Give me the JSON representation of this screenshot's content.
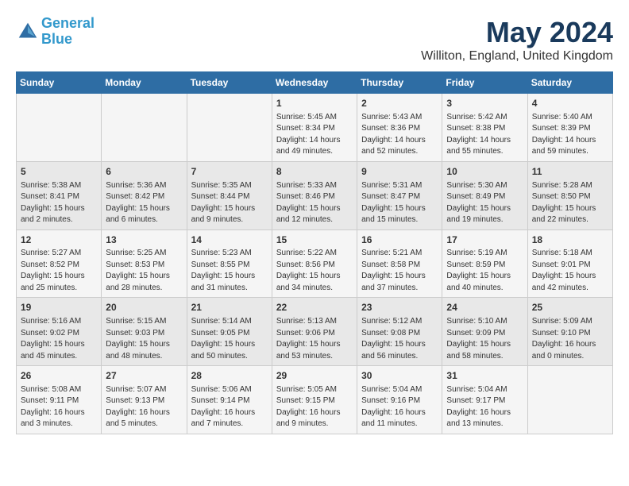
{
  "header": {
    "logo_line1": "General",
    "logo_line2": "Blue",
    "month_title": "May 2024",
    "location": "Williton, England, United Kingdom"
  },
  "days_of_week": [
    "Sunday",
    "Monday",
    "Tuesday",
    "Wednesday",
    "Thursday",
    "Friday",
    "Saturday"
  ],
  "rows": [
    {
      "cells": [
        {
          "day": "",
          "content": ""
        },
        {
          "day": "",
          "content": ""
        },
        {
          "day": "",
          "content": ""
        },
        {
          "day": "1",
          "content": "Sunrise: 5:45 AM\nSunset: 8:34 PM\nDaylight: 14 hours\nand 49 minutes."
        },
        {
          "day": "2",
          "content": "Sunrise: 5:43 AM\nSunset: 8:36 PM\nDaylight: 14 hours\nand 52 minutes."
        },
        {
          "day": "3",
          "content": "Sunrise: 5:42 AM\nSunset: 8:38 PM\nDaylight: 14 hours\nand 55 minutes."
        },
        {
          "day": "4",
          "content": "Sunrise: 5:40 AM\nSunset: 8:39 PM\nDaylight: 14 hours\nand 59 minutes."
        }
      ]
    },
    {
      "cells": [
        {
          "day": "5",
          "content": "Sunrise: 5:38 AM\nSunset: 8:41 PM\nDaylight: 15 hours\nand 2 minutes."
        },
        {
          "day": "6",
          "content": "Sunrise: 5:36 AM\nSunset: 8:42 PM\nDaylight: 15 hours\nand 6 minutes."
        },
        {
          "day": "7",
          "content": "Sunrise: 5:35 AM\nSunset: 8:44 PM\nDaylight: 15 hours\nand 9 minutes."
        },
        {
          "day": "8",
          "content": "Sunrise: 5:33 AM\nSunset: 8:46 PM\nDaylight: 15 hours\nand 12 minutes."
        },
        {
          "day": "9",
          "content": "Sunrise: 5:31 AM\nSunset: 8:47 PM\nDaylight: 15 hours\nand 15 minutes."
        },
        {
          "day": "10",
          "content": "Sunrise: 5:30 AM\nSunset: 8:49 PM\nDaylight: 15 hours\nand 19 minutes."
        },
        {
          "day": "11",
          "content": "Sunrise: 5:28 AM\nSunset: 8:50 PM\nDaylight: 15 hours\nand 22 minutes."
        }
      ]
    },
    {
      "cells": [
        {
          "day": "12",
          "content": "Sunrise: 5:27 AM\nSunset: 8:52 PM\nDaylight: 15 hours\nand 25 minutes."
        },
        {
          "day": "13",
          "content": "Sunrise: 5:25 AM\nSunset: 8:53 PM\nDaylight: 15 hours\nand 28 minutes."
        },
        {
          "day": "14",
          "content": "Sunrise: 5:23 AM\nSunset: 8:55 PM\nDaylight: 15 hours\nand 31 minutes."
        },
        {
          "day": "15",
          "content": "Sunrise: 5:22 AM\nSunset: 8:56 PM\nDaylight: 15 hours\nand 34 minutes."
        },
        {
          "day": "16",
          "content": "Sunrise: 5:21 AM\nSunset: 8:58 PM\nDaylight: 15 hours\nand 37 minutes."
        },
        {
          "day": "17",
          "content": "Sunrise: 5:19 AM\nSunset: 8:59 PM\nDaylight: 15 hours\nand 40 minutes."
        },
        {
          "day": "18",
          "content": "Sunrise: 5:18 AM\nSunset: 9:01 PM\nDaylight: 15 hours\nand 42 minutes."
        }
      ]
    },
    {
      "cells": [
        {
          "day": "19",
          "content": "Sunrise: 5:16 AM\nSunset: 9:02 PM\nDaylight: 15 hours\nand 45 minutes."
        },
        {
          "day": "20",
          "content": "Sunrise: 5:15 AM\nSunset: 9:03 PM\nDaylight: 15 hours\nand 48 minutes."
        },
        {
          "day": "21",
          "content": "Sunrise: 5:14 AM\nSunset: 9:05 PM\nDaylight: 15 hours\nand 50 minutes."
        },
        {
          "day": "22",
          "content": "Sunrise: 5:13 AM\nSunset: 9:06 PM\nDaylight: 15 hours\nand 53 minutes."
        },
        {
          "day": "23",
          "content": "Sunrise: 5:12 AM\nSunset: 9:08 PM\nDaylight: 15 hours\nand 56 minutes."
        },
        {
          "day": "24",
          "content": "Sunrise: 5:10 AM\nSunset: 9:09 PM\nDaylight: 15 hours\nand 58 minutes."
        },
        {
          "day": "25",
          "content": "Sunrise: 5:09 AM\nSunset: 9:10 PM\nDaylight: 16 hours\nand 0 minutes."
        }
      ]
    },
    {
      "cells": [
        {
          "day": "26",
          "content": "Sunrise: 5:08 AM\nSunset: 9:11 PM\nDaylight: 16 hours\nand 3 minutes."
        },
        {
          "day": "27",
          "content": "Sunrise: 5:07 AM\nSunset: 9:13 PM\nDaylight: 16 hours\nand 5 minutes."
        },
        {
          "day": "28",
          "content": "Sunrise: 5:06 AM\nSunset: 9:14 PM\nDaylight: 16 hours\nand 7 minutes."
        },
        {
          "day": "29",
          "content": "Sunrise: 5:05 AM\nSunset: 9:15 PM\nDaylight: 16 hours\nand 9 minutes."
        },
        {
          "day": "30",
          "content": "Sunrise: 5:04 AM\nSunset: 9:16 PM\nDaylight: 16 hours\nand 11 minutes."
        },
        {
          "day": "31",
          "content": "Sunrise: 5:04 AM\nSunset: 9:17 PM\nDaylight: 16 hours\nand 13 minutes."
        },
        {
          "day": "",
          "content": ""
        }
      ]
    }
  ]
}
